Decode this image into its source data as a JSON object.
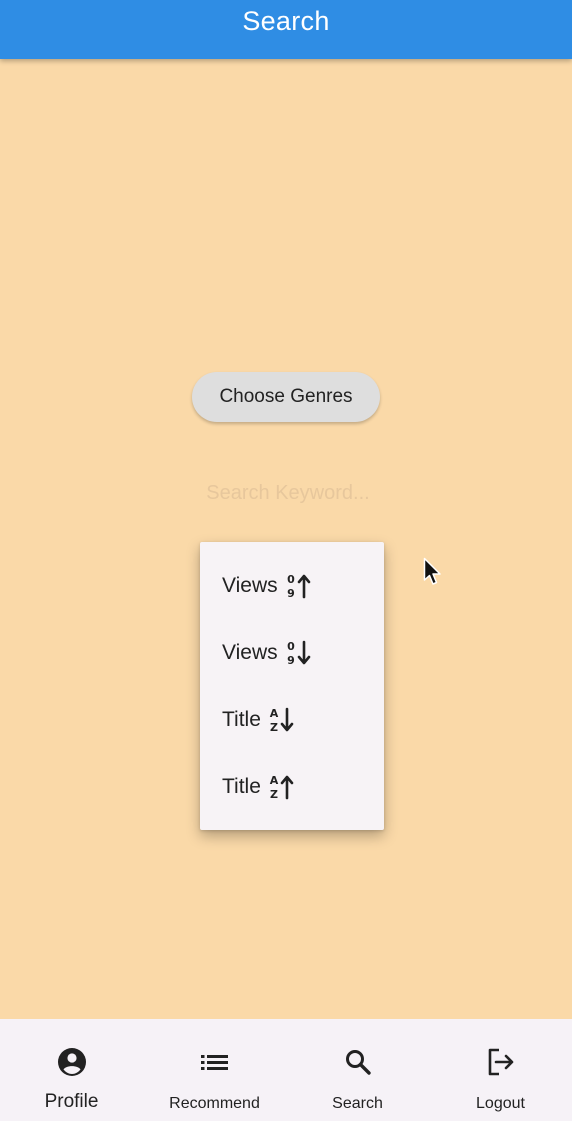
{
  "appbar": {
    "title": "Search"
  },
  "genres_button": {
    "label": "Choose Genres"
  },
  "search": {
    "placeholder": "Search Keyword...",
    "value": ""
  },
  "sort_menu": {
    "items": [
      {
        "label": "Views",
        "icon": "sort-numeric-ascending-icon"
      },
      {
        "label": "Views",
        "icon": "sort-numeric-descending-icon"
      },
      {
        "label": "Title",
        "icon": "sort-alpha-descending-icon"
      },
      {
        "label": "Title",
        "icon": "sort-alpha-ascending-icon"
      }
    ]
  },
  "bottom_nav": {
    "items": [
      {
        "label": "Profile",
        "icon": "account-circle-icon",
        "active": true
      },
      {
        "label": "Recommend",
        "icon": "list-icon",
        "active": false
      },
      {
        "label": "Search",
        "icon": "search-icon",
        "active": false
      },
      {
        "label": "Logout",
        "icon": "logout-icon",
        "active": false
      }
    ]
  },
  "colors": {
    "appbar": "#2f8de4",
    "background": "#fad9a8",
    "menu": "#f7f3f6",
    "bottom_nav": "#f6f2f7",
    "placeholder": "#e7c79c"
  }
}
